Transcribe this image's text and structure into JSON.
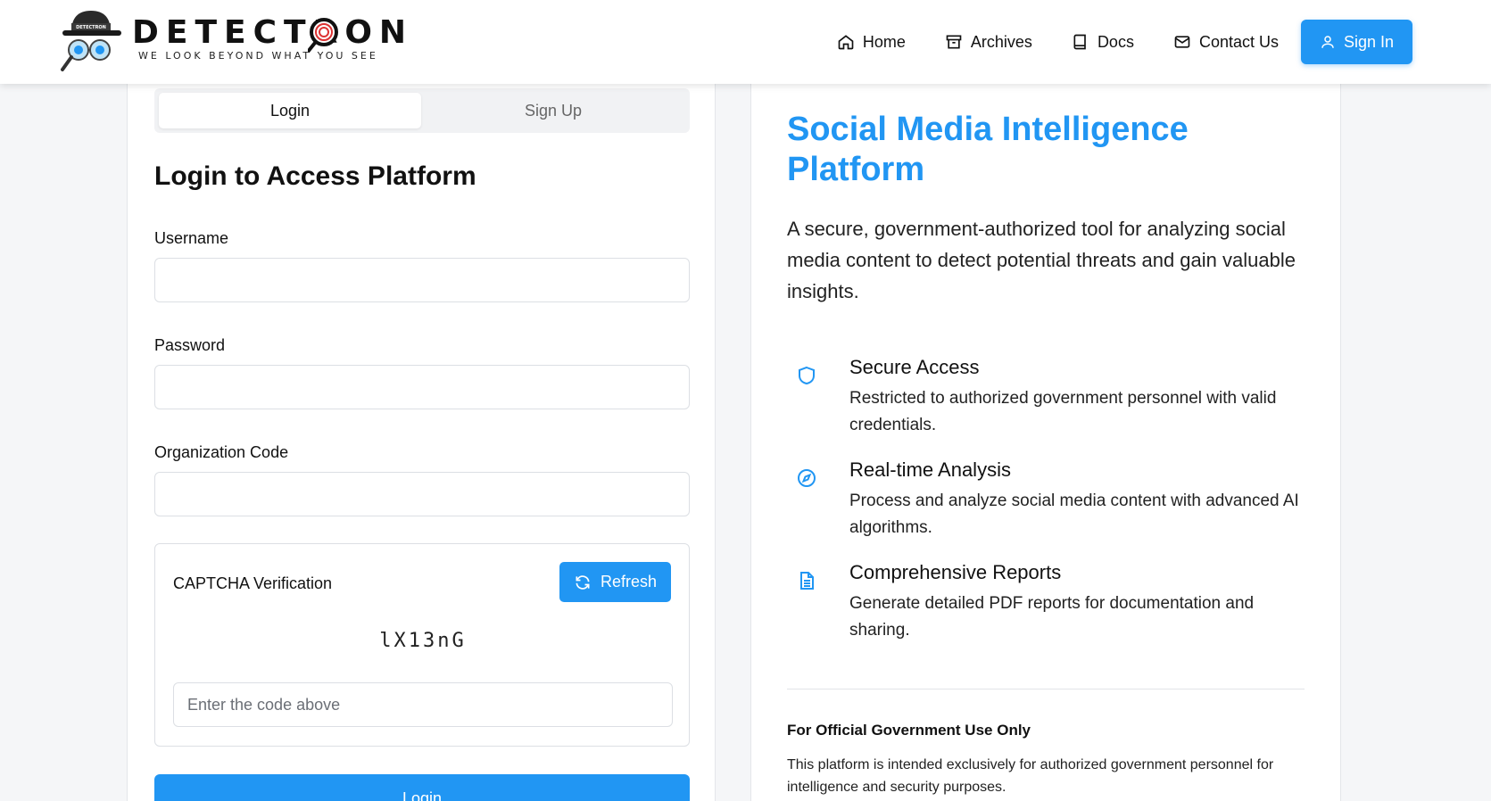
{
  "brand": {
    "name": "DETECTRON",
    "tagline": "WE LOOK BEYOND WHAT YOU SEE",
    "hat_text": "DETECTRON",
    "accent": "#2196f3"
  },
  "nav": {
    "items": [
      {
        "label": "Home",
        "icon": "home-icon"
      },
      {
        "label": "Archives",
        "icon": "archive-icon"
      },
      {
        "label": "Docs",
        "icon": "book-icon"
      },
      {
        "label": "Contact Us",
        "icon": "mail-icon"
      }
    ],
    "signin_label": "Sign In"
  },
  "auth": {
    "tabs": [
      "Login",
      "Sign Up"
    ],
    "active_tab": "Login",
    "title": "Login to Access Platform",
    "fields": {
      "username_label": "Username",
      "username_value": "",
      "password_label": "Password",
      "password_value": "",
      "org_label": "Organization Code",
      "org_value": ""
    },
    "captcha": {
      "label": "CAPTCHA Verification",
      "refresh_label": "Refresh",
      "code": "lX13nG",
      "placeholder": "Enter the code above",
      "value": ""
    },
    "submit_label": "Login"
  },
  "info": {
    "title": "Social Media Intelligence Platform",
    "description": "A secure, government-authorized tool for analyzing social media content to detect potential threats and gain valuable insights.",
    "features": [
      {
        "icon": "shield-icon",
        "title": "Secure Access",
        "desc": "Restricted to authorized government personnel with valid credentials."
      },
      {
        "icon": "compass-icon",
        "title": "Real-time Analysis",
        "desc": "Process and analyze social media content with advanced AI algorithms."
      },
      {
        "icon": "document-icon",
        "title": "Comprehensive Reports",
        "desc": "Generate detailed PDF reports for documentation and sharing."
      }
    ],
    "official_title": "For Official Government Use Only",
    "official_desc": "This platform is intended exclusively for authorized government personnel for intelligence and security purposes."
  }
}
